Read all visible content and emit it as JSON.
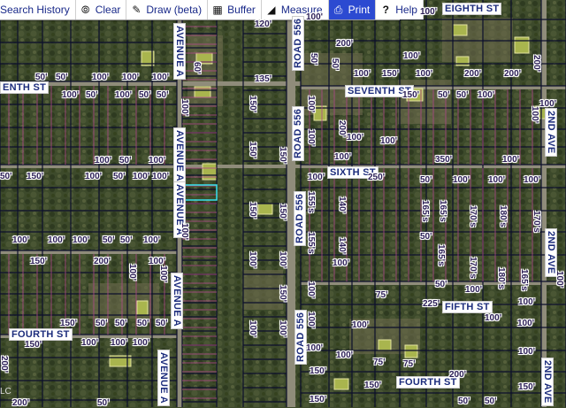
{
  "toolbar": {
    "search_history": "Search History",
    "clear": "Clear",
    "draw": "Draw (beta)",
    "buffer": "Buffer",
    "measure": "Measure",
    "print": "Print",
    "help": "Help"
  },
  "streets": {
    "eighth_st": "EIGHTH ST",
    "seventh_st": "SEVENTH ST",
    "seventh_st_w": "ENTH ST",
    "sixth_st": "SIXTH ST",
    "fifth_st": "FIFTH ST",
    "fourth_st": "FOURTH ST",
    "fourth_st_e": "FOURTH ST",
    "avenue_a": "AVENUE A",
    "road_556": "ROAD 556",
    "second_ave": "2ND AVE"
  },
  "dimensions": {
    "d50": "50'",
    "d60": "60'",
    "d75": "75'",
    "d100": "100'",
    "d120": "120'",
    "d140": "140'",
    "d150": "150'",
    "d165s": "165's",
    "d170s": "170's",
    "d180s": "180's",
    "d200": "200'",
    "d225": "225'",
    "d250": "250'",
    "d350": "350'",
    "d155s": "155's",
    "d135": "135'"
  },
  "corner_text": "LC"
}
